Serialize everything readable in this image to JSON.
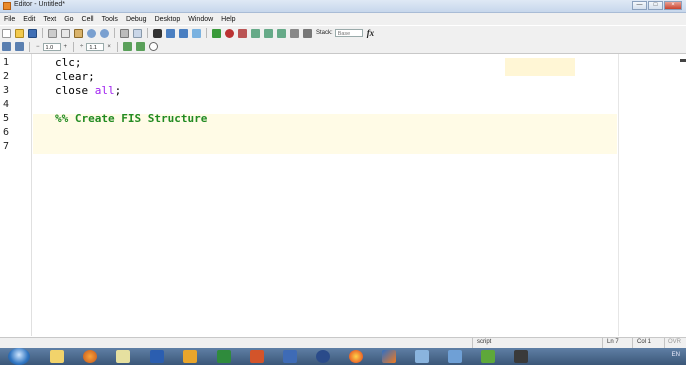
{
  "window": {
    "title": "Editor - Untitled*",
    "controls": {
      "minimize": "—",
      "maximize": "□",
      "close": "×"
    }
  },
  "menu": [
    "File",
    "Edit",
    "Text",
    "Go",
    "Cell",
    "Tools",
    "Debug",
    "Desktop",
    "Window",
    "Help"
  ],
  "toolbar": {
    "stack_label": "Stack:",
    "stack_value": "Base",
    "fx_label": "fx"
  },
  "cell_toolbar": {
    "minus": "−",
    "step_value": "1.0",
    "plus": "+",
    "divide": "÷",
    "scale_value": "1.1",
    "times": "×"
  },
  "line_numbers": [
    "1",
    "2",
    "3",
    "4",
    "5",
    "6",
    "7"
  ],
  "code": {
    "line1": "clc;",
    "line2": "clear;",
    "line3_cmd": "close ",
    "line3_arg": "all",
    "line3_end": ";",
    "line5": "%% Create FIS Structure"
  },
  "status": {
    "mode": "script",
    "ln": "Ln  7",
    "col": "Col  1",
    "ovr": "OVR"
  },
  "taskbar": {
    "icons": [
      "start-orb",
      "explorer-icon",
      "firefox-icon",
      "pen-icon",
      "word-icon",
      "outlook-icon",
      "excel-icon",
      "powerpoint-icon",
      "visio-icon",
      "link-icon",
      "star-icon",
      "matlab-icon",
      "app-icon",
      "window-icon",
      "download-icon",
      "network-icon"
    ],
    "language": "EN"
  }
}
